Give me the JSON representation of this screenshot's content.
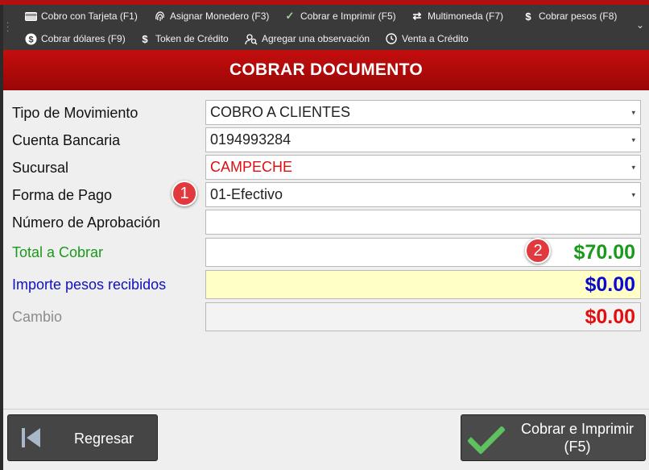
{
  "toolbar": {
    "row1": [
      {
        "label": "Cobro con Tarjeta (F1)",
        "icon": "credit-card-icon"
      },
      {
        "label": "Asignar Monedero (F3)",
        "icon": "fingerprint-icon"
      },
      {
        "label": "Cobrar e Imprimir (F5)",
        "icon": "check-icon"
      },
      {
        "label": "Multimoneda (F7)",
        "icon": "exchange-icon"
      },
      {
        "label": "Cobrar pesos (F8)",
        "icon": "dollar-icon"
      }
    ],
    "row2": [
      {
        "label": "Cobrar dólares (F9)",
        "icon": "dollar-circle-icon"
      },
      {
        "label": "Token de Crédito",
        "icon": "dollar-icon"
      },
      {
        "label": "Agregar una observación",
        "icon": "user-search-icon"
      },
      {
        "label": "Venta a Crédito",
        "icon": "clock-icon"
      }
    ]
  },
  "header": {
    "title": "COBRAR DOCUMENTO"
  },
  "form": {
    "tipo_movimiento": {
      "label": "Tipo de Movimiento",
      "value": "COBRO A CLIENTES"
    },
    "cuenta_bancaria": {
      "label": "Cuenta Bancaria",
      "value": "0194993284"
    },
    "sucursal": {
      "label": "Sucursal",
      "value": "CAMPECHE"
    },
    "forma_pago": {
      "label": "Forma de Pago",
      "value": "01-Efectivo"
    },
    "numero_aprobacion": {
      "label": "Número de Aprobación",
      "value": ""
    },
    "total_cobrar": {
      "label": "Total a Cobrar",
      "value": "$70.00"
    },
    "importe_recibido": {
      "label": "Importe pesos recibidos",
      "value": "$0.00"
    },
    "cambio": {
      "label": "Cambio",
      "value": "$0.00"
    }
  },
  "badges": {
    "one": "1",
    "two": "2"
  },
  "buttons": {
    "regresar": "Regresar",
    "cobrar_line1": "Cobrar e Imprimir",
    "cobrar_line2": "(F5)"
  },
  "colors": {
    "header_red": "#b80a0a",
    "total_green": "#1a9a1a",
    "importe_blue": "#1010c0",
    "cambio_red": "#e01010",
    "sucursal_red": "#e01010"
  }
}
